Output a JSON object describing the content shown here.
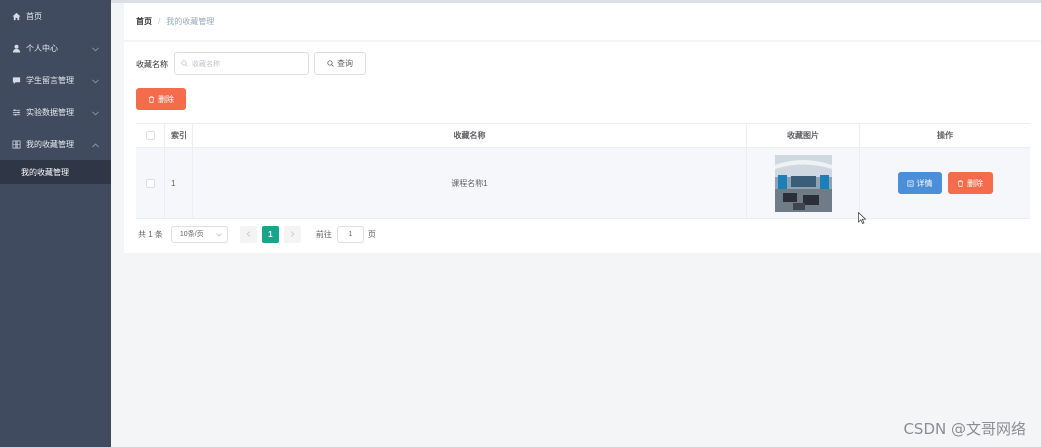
{
  "sidebar": {
    "items": [
      {
        "label": "首页",
        "icon": "home-icon"
      },
      {
        "label": "个人中心",
        "icon": "user-icon",
        "expandable": true
      },
      {
        "label": "学生留言管理",
        "icon": "message-icon",
        "expandable": true
      },
      {
        "label": "实验数据管理",
        "icon": "sliders-icon",
        "expandable": true
      },
      {
        "label": "我的收藏管理",
        "icon": "grid-icon",
        "expandable": true,
        "expanded": true
      }
    ],
    "submenu": [
      {
        "label": "我的收藏管理"
      }
    ]
  },
  "breadcrumb": {
    "home": "首页",
    "separator": "/",
    "current": "我的收藏管理"
  },
  "search": {
    "label": "收藏名称",
    "placeholder": "收藏名称",
    "button": "查询"
  },
  "toolbar": {
    "delete_label": "删除"
  },
  "table": {
    "columns": [
      "索引",
      "收藏名称",
      "收藏图片",
      "操作"
    ],
    "rows": [
      {
        "index": "1",
        "name": "课程名称1",
        "detail_label": "详情",
        "delete_label": "删除"
      }
    ]
  },
  "pagination": {
    "total": "共 1 条",
    "page_size": "10条/页",
    "current_page": "1",
    "goto_label": "前往",
    "goto_value": "1",
    "page_suffix": "页"
  },
  "watermark": "CSDN @文哥网络",
  "colors": {
    "sidebar": "#414b5f",
    "sidebar_active": "#2f3646",
    "danger": "#f56c4c",
    "primary": "#4a8fd8",
    "page_active": "#19a589"
  }
}
